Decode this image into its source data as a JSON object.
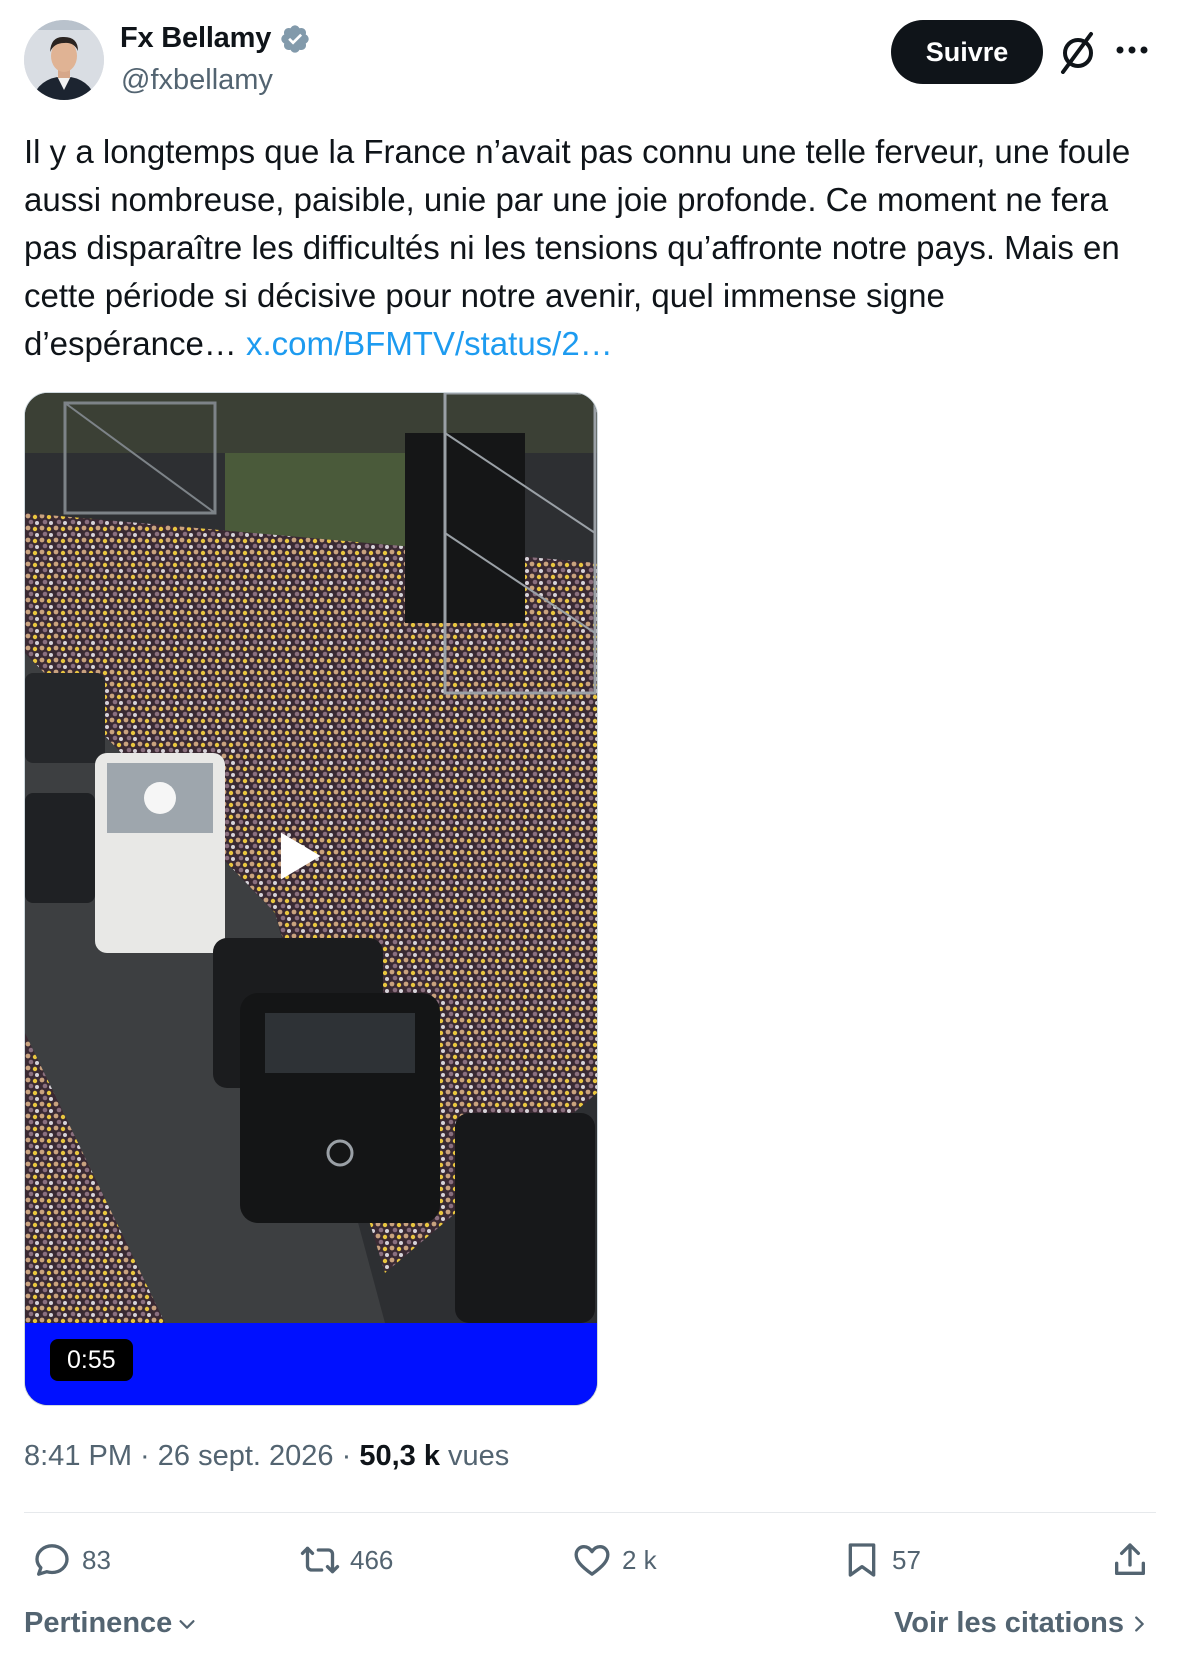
{
  "author": {
    "display_name": "Fx Bellamy",
    "handle": "@fxbellamy",
    "verified_icon": "verified-badge-icon"
  },
  "header": {
    "follow_label": "Suivre",
    "grok_icon": "grok-icon",
    "more_icon": "more-options-icon"
  },
  "tweet": {
    "text": "Il y a longtemps que la France n’avait pas connu une telle ferveur, une foule aussi nombreuse, paisible, unie par une joie profonde. Ce moment ne fera pas disparaître les difficultés ni les tensions qu’affronte notre pays. Mais en cette période si décisive pour notre avenir, quel immense signe d’espérance… ",
    "link_text": "x.com/BFMTV/status/2…"
  },
  "video": {
    "duration": "0:55",
    "bar_color": "#0010ff"
  },
  "meta": {
    "time": "8:41 PM",
    "separator": " · ",
    "date": "26 sept. 2026",
    "views_count": "50,3 k",
    "views_label": " vues"
  },
  "actions": {
    "replies": "83",
    "reposts": "466",
    "likes": "2 k",
    "bookmarks": "57"
  },
  "footer": {
    "sort_label": "Pertinence",
    "quotes_label": "Voir les citations"
  },
  "colors": {
    "text": "#0f1419",
    "secondary": "#536471",
    "link": "#1d9bf0",
    "verified": "#829aab"
  }
}
